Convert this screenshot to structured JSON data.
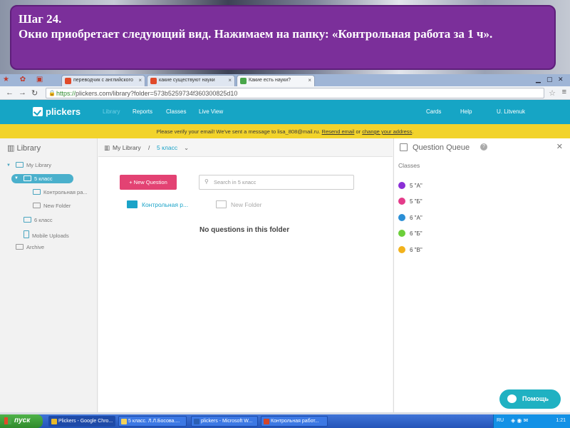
{
  "banner": {
    "line1": "Шаг 24.",
    "line2": "Окно приобретает следующий вид. Нажимаем на папку: «Контрольная работа за 1 ч»."
  },
  "browser": {
    "tabs": [
      {
        "label": "переводчик с английского",
        "icon": "translate-icon",
        "color": "#e04a2a"
      },
      {
        "label": "какие существуют науки",
        "icon": "yandex-icon",
        "color": "#e04a2a"
      },
      {
        "label": "Какие есть науки?",
        "icon": "answers-icon",
        "color": "#49a64a"
      }
    ],
    "url_scheme": "https://",
    "url_rest": "plickers.com/library?folder=573b5259734f360300825d10"
  },
  "app": {
    "logo": "plickers",
    "nav": [
      "Library",
      "Reports",
      "Classes",
      "Live View"
    ],
    "nav_right": [
      "Cards",
      "Help",
      "U. Litvenuk"
    ],
    "verify_pre": "Please verify your email! We've sent a message to lisa_808@mail.ru.",
    "verify_link1": "Resend email",
    "verify_mid": "or",
    "verify_link2": "change your address",
    "verify_end": "."
  },
  "sidebar": {
    "title": "Library",
    "items": [
      {
        "label": "My Library"
      },
      {
        "label": "5 класс"
      },
      {
        "label": "Контрольная ра..."
      },
      {
        "label": "New Folder"
      },
      {
        "label": "6 класс"
      },
      {
        "label": "Mobile Uploads"
      },
      {
        "label": "Archive"
      }
    ]
  },
  "center": {
    "breadcrumb_root": "My Library",
    "breadcrumb_sep": "/",
    "breadcrumb_current": "5 класс",
    "new_question": "+ New Question",
    "search_placeholder": "Search in 5 класс",
    "folders": [
      {
        "label": "Контрольная р...",
        "color": "#1aa3c8"
      },
      {
        "label": "New Folder",
        "color": "#bbbbbb"
      }
    ],
    "empty_text": "No questions in this folder"
  },
  "queue": {
    "title": "Question Queue",
    "classes_label": "Classes",
    "classes": [
      {
        "name": "5 \"А\"",
        "color": "#8b2fd6"
      },
      {
        "name": "5 \"Б\"",
        "color": "#e43b8a"
      },
      {
        "name": "6 \"А\"",
        "color": "#2b8fd6"
      },
      {
        "name": "6 \"Б\"",
        "color": "#6ccf3a"
      },
      {
        "name": "6 \"В\"",
        "color": "#f2b21c"
      }
    ]
  },
  "help_button": "Помощь",
  "taskbar": {
    "start": "пуск",
    "tasks": [
      {
        "label": "Plickers - Google Chro...",
        "color": "#e8b92a"
      },
      {
        "label": "5 класс. Л.Л.Босова....",
        "color": "#f3d25a"
      },
      {
        "label": "plickers - Microsoft W...",
        "color": "#2b5fb4"
      },
      {
        "label": "Контрольная работ...",
        "color": "#d2452a"
      }
    ],
    "lang": "RU",
    "clock": "1:21"
  }
}
